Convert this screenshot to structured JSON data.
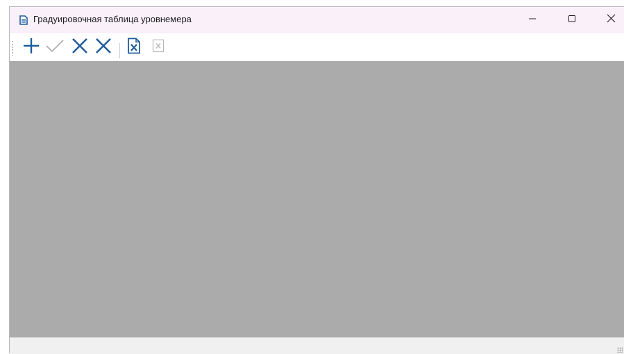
{
  "window": {
    "title": "Градуировочная таблица уровнемера",
    "icon": "document-icon"
  },
  "caption_buttons": {
    "minimize": "minimize-icon",
    "maximize": "maximize-icon",
    "close": "close-icon"
  },
  "toolbar": {
    "items": [
      {
        "name": "add-button",
        "icon": "plus-icon",
        "color": "#1f5d9c",
        "enabled": true
      },
      {
        "name": "apply-button",
        "icon": "check-icon",
        "color": "#b8b8b8",
        "enabled": false
      },
      {
        "name": "delete-button",
        "icon": "cross-icon",
        "color": "#1f5d9c",
        "enabled": true
      },
      {
        "name": "delete-all-button",
        "icon": "cross-icon",
        "color": "#1f5d9c",
        "enabled": true
      },
      {
        "name": "import-excel-button",
        "icon": "excel-file-icon",
        "color": "#1f5d9c",
        "enabled": true
      },
      {
        "name": "export-excel-button",
        "icon": "excel-file-icon",
        "color": "#b8b8b8",
        "enabled": false
      }
    ]
  },
  "colors": {
    "titlebar": "#f9f0fa",
    "content": "#ababab",
    "accent": "#1f5d9c"
  }
}
